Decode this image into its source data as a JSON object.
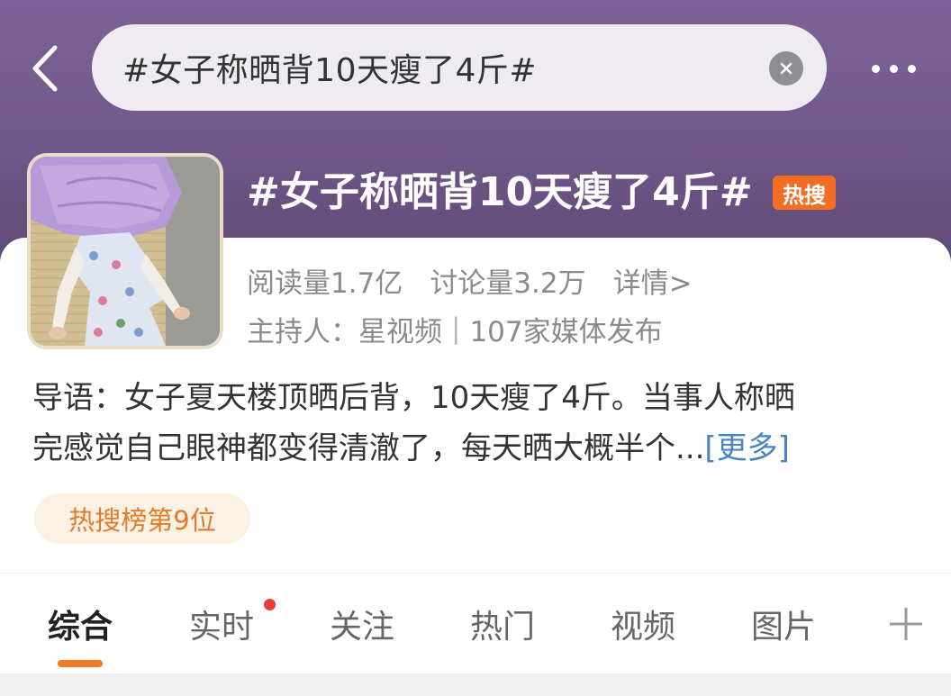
{
  "header": {
    "search_text": "#女子称晒背10天瘦了4斤#",
    "back_icon": "chevron-left-icon",
    "clear_icon": "close-circle-icon",
    "more_icon": "more-horizontal-icon"
  },
  "topic": {
    "title": "#女子称晒背10天瘦了4斤#",
    "hot_badge": "热搜",
    "reads": "阅读量1.7亿",
    "discussions": "讨论量3.2万",
    "details_link": "详情>",
    "host_label": "主持人：",
    "host_name": "星视频",
    "separator": "|",
    "publishers": "107家媒体发布",
    "cover_image": "cover-photo-woman-sunbathing"
  },
  "intro": {
    "line1": "导语：女子夏天楼顶晒后背，10天瘦了4斤。当事人称晒",
    "line2_text": "完感觉自己眼神都变得清澈了，每天晒大概半个...",
    "more_label": "[更多]"
  },
  "rank_badge": "热搜榜第9位",
  "tabs": [
    {
      "label": "综合",
      "active": true
    },
    {
      "label": "实时",
      "active": false,
      "has_notification_dot": true
    },
    {
      "label": "关注",
      "active": false
    },
    {
      "label": "热门",
      "active": false
    },
    {
      "label": "视频",
      "active": false
    },
    {
      "label": "图片",
      "active": false
    }
  ],
  "add_tab_icon": "plus-icon",
  "colors": {
    "header_bg": "#735a8c",
    "hot_badge": "#f36d24",
    "link": "#4a82c3",
    "tab_indicator": "#f07a2a",
    "rank_text": "#e37a2a"
  }
}
